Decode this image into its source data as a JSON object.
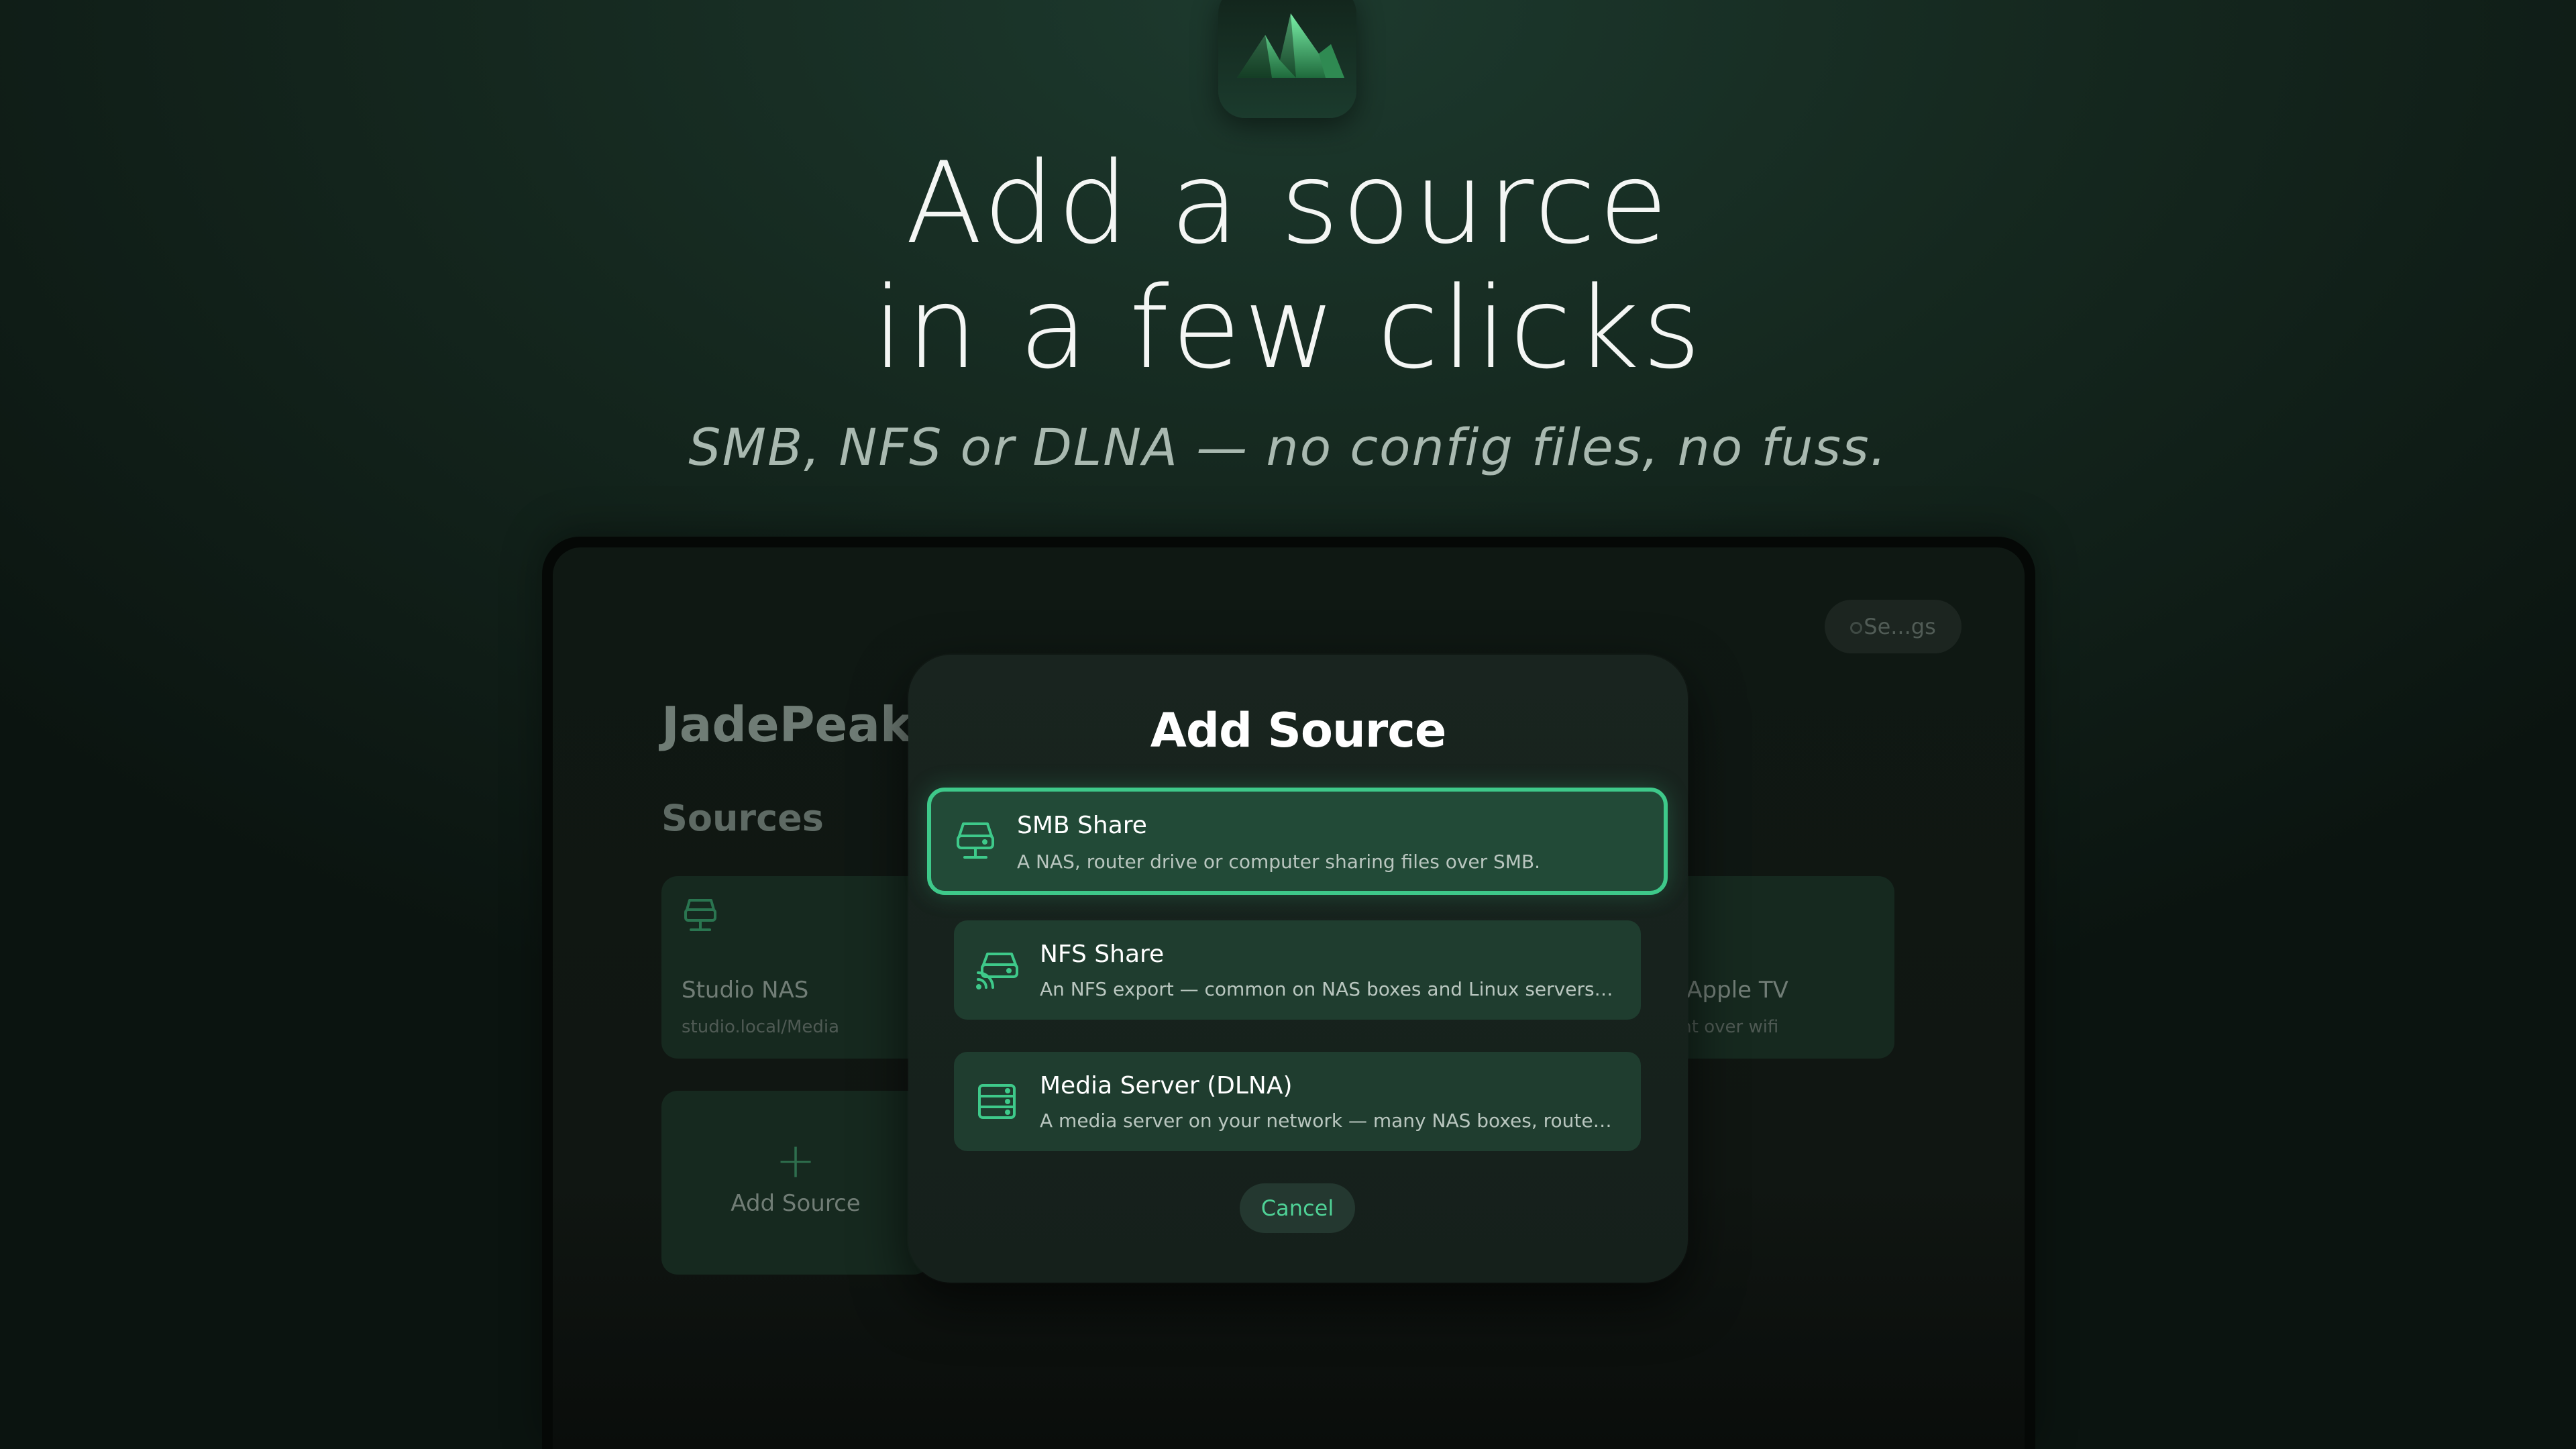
{
  "hero": {
    "title_line1": "Add a source",
    "title_line2": "in a few clicks",
    "subtitle": "SMB, NFS or DLNA — no config files, no fuss."
  },
  "app": {
    "name": "JadePeak",
    "settings_label": "Se...gs",
    "sources_heading": "Sources",
    "cards": [
      {
        "name": "Studio NAS",
        "detail": "studio.local/Media",
        "icon": "server-icon"
      },
      {
        "name": "This Apple TV",
        "detail": "eos sent over wifi",
        "icon": "device-icon"
      }
    ],
    "add_card": {
      "plus": "+",
      "label": "Add Source"
    }
  },
  "modal": {
    "title": "Add Source",
    "options": [
      {
        "title": "SMB Share",
        "description": "A NAS, router drive or computer sharing files over SMB.",
        "icon": "smb-drive-icon"
      },
      {
        "title": "NFS Share",
        "description": "An NFS export — common on NAS boxes and Linux servers. No p...",
        "icon": "nfs-drive-icon"
      },
      {
        "title": "Media Server (DLNA)",
        "description": "A media server on your network — many NAS boxes, routers and...",
        "icon": "media-server-icon"
      }
    ],
    "cancel_label": "Cancel"
  },
  "colors": {
    "accent": "#3ec98a",
    "accent_text": "#4fd196",
    "background": "#15281f"
  }
}
